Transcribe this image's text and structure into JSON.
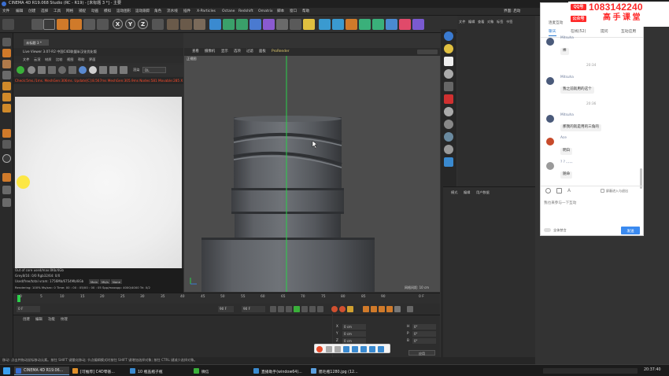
{
  "window": {
    "title": "CINEMA 4D R19.068 Studio (RC - R19) - [未标题 3 *] - 主要",
    "controls": [
      "–",
      "□",
      "×"
    ]
  },
  "menu": [
    "文件",
    "编辑",
    "创建",
    "选择",
    "工具",
    "网格",
    "捕捉",
    "动画",
    "模拟",
    "运动图形",
    "运动跟踪",
    "角色",
    "流水线",
    "插件",
    "X-Particles",
    "Octane",
    "Redshift",
    "Omatrix",
    "脚本",
    "窗口",
    "帮助"
  ],
  "menu_right": "界面: 启动",
  "toolbar": {
    "axes": [
      "X",
      "Y",
      "Z"
    ]
  },
  "live_viewer": {
    "tab": "未标题 3 *",
    "header": "Live Viewer 3.07-R2 中国C4D联盟半汉化优化版",
    "menu": [
      "文件",
      "云渲",
      "材质",
      "比较",
      "视图",
      "帮助",
      "界面"
    ],
    "mode_label": "渲染",
    "mode_value": "DL",
    "status": "Check:5ms./1ms. MeshGen:306ms. Update[C]:8.567ms MeshGen:305.9ms Nodes:581 Movable:285 X",
    "info": [
      "Out of core used/max:0Kb/4Gb",
      "Grey8/16: 0/0          Rgb32/64: 0/0",
      "Used/free/total vram: 1756Mb/6754Mb/8Gb",
      "Rendering: 100%   Ms/sec: 0   Time: 00 : 00 : 05/00 : 00 : 05   Spp/maxspp: 4000/4000   Tri: 0/2"
    ],
    "info_badges": [
      "Main",
      "Mb/s",
      "None"
    ]
  },
  "viewport": {
    "menu": [
      "查看",
      "摄像机",
      "显示",
      "选项",
      "过滤",
      "面板",
      "ProRender"
    ],
    "label": "正视图",
    "grid": "网格间距: 10 cm"
  },
  "timeline": {
    "ticks": [
      "0",
      "5",
      "10",
      "15",
      "20",
      "25",
      "30",
      "35",
      "40",
      "45",
      "50",
      "55",
      "60",
      "65",
      "70",
      "75",
      "80",
      "85",
      "90"
    ],
    "current_frame": "0 F",
    "start": "0 F",
    "end": "90 F",
    "end2": "90 F"
  },
  "material_panel": {
    "tabs": [
      "创建",
      "编辑",
      "功能",
      "纹理"
    ]
  },
  "coord_panel": {
    "labels": [
      "X",
      "Y",
      "Z"
    ],
    "values": [
      "0 cm",
      "0 cm",
      "0 cm"
    ],
    "hpb": [
      "H",
      "P",
      "B"
    ],
    "hpb_values": [
      "0°",
      "0°",
      "0°"
    ],
    "apply": "应用"
  },
  "object_panel": {
    "tabs": [
      "文件",
      "编辑",
      "查看",
      "对象",
      "标签",
      "书签"
    ]
  },
  "attr_panel": {
    "tabs": [
      "模式",
      "编辑",
      "用户数据"
    ]
  },
  "status_bar": "移动: 点击并拖动鼠标移动元素。按住 SHIFT 键量化移动; 节点编辑模式时按住 SHIFT 键增加选择对象; 按住 CTRL 键减少选择对象。",
  "chat": {
    "header": "连麦互动",
    "tabs": [
      "聊天",
      "在线(52)",
      "提问",
      "互动应用"
    ],
    "messages": [
      {
        "type": "msg",
        "user": "Mitsuha",
        "text": "棒",
        "avatar_color": "#4a5a7a"
      },
      {
        "type": "time",
        "text": "20:34"
      },
      {
        "type": "msg",
        "user": "Mitsuha",
        "text": "我之前就用的这个",
        "avatar_color": "#4a5a7a"
      },
      {
        "type": "time",
        "text": "20:36"
      },
      {
        "type": "msg",
        "user": "Mitsuha",
        "text": "那我的就是用的三角的",
        "avatar_color": "#4a5a7a"
      },
      {
        "type": "msg",
        "user": "Ace",
        "text": "明白",
        "avatar_color": "#c74a2a"
      },
      {
        "type": "msg",
        "user": "? ? 、、、、",
        "text": "随命",
        "avatar_color": "#9a9a9a"
      }
    ],
    "block_option": "屏蔽进入与退出",
    "input_placeholder": "我也来参与一下互动",
    "mute_label": "全体禁言",
    "send_label": "发送"
  },
  "qq_banner": {
    "qq_badge": "QQ号",
    "number": "1083142240",
    "public_badge": "公众号",
    "slogan": "高手课堂"
  },
  "taskbar": {
    "items": [
      "CINEMA 4D R19.06...",
      "[可推荐] C4D零基...",
      "10 瓶盖瓶子瓶",
      "微信",
      "直播助手(window64)...",
      "腊毛瓶1280.jpg (12..."
    ],
    "clock": "20:37:40"
  }
}
